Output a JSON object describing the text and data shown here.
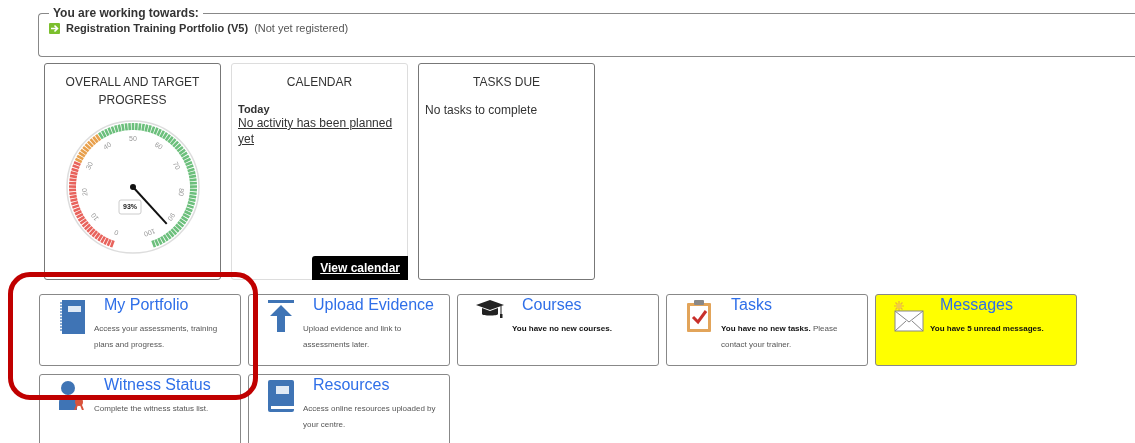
{
  "goal": {
    "legend": "You are working towards:",
    "title": "Registration Training Portfolio (V5)",
    "status": "(Not yet registered)"
  },
  "cards": [
    {
      "kind": "gauge",
      "title": "OVERALL AND TARGET PROGRESS",
      "gauge": {
        "reading": "93%",
        "tick_labels": [
          "0",
          "10",
          "20",
          "30",
          "40",
          "50",
          "60",
          "70",
          "80",
          "90",
          "100"
        ]
      }
    },
    {
      "kind": "calendar",
      "title": "CALENDAR",
      "day": "Today",
      "activity": "No activity has been planned yet",
      "button": "View calendar"
    },
    {
      "kind": "tasks",
      "title": "TASKS DUE",
      "text": "No tasks to complete"
    }
  ],
  "tiles": [
    {
      "kind": "portfolio",
      "title": "My Portfolio",
      "description": "Access your assessments, training plans and progress.",
      "bold": false,
      "highlighted": false
    },
    {
      "kind": "upload",
      "title": "Upload Evidence",
      "description": "Upload evidence and link to assessments later.",
      "bold": false,
      "highlighted": false
    },
    {
      "kind": "courses",
      "title": "Courses",
      "description": "You have no new courses.",
      "bold": true,
      "highlighted": false
    },
    {
      "kind": "tasks",
      "title": "Tasks",
      "description": "**You have no new tasks.** Please contact your trainer.",
      "bold": false,
      "highlighted": false
    },
    {
      "kind": "messages",
      "title": "Messages",
      "description": "You have 5 unread messages.",
      "bold": true,
      "highlighted": true
    },
    {
      "kind": "witness",
      "title": "Witness Status",
      "description": "Complete the witness status list.",
      "bold": false,
      "highlighted": false
    },
    {
      "kind": "resources",
      "title": "Resources",
      "description": "Access online resources uploaded by your centre.",
      "bold": false,
      "highlighted": false
    }
  ]
}
